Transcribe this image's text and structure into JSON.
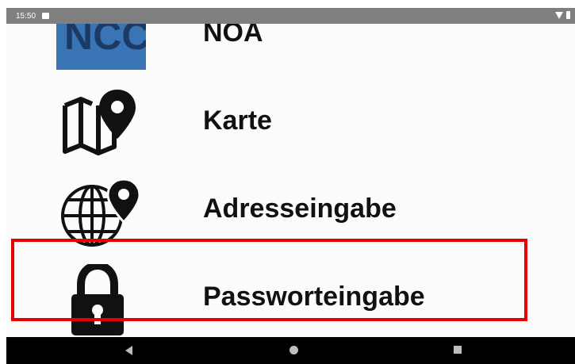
{
  "status_bar": {
    "time": "15:50",
    "notification_icon": "image-icon",
    "wifi_icon": "wifi-icon",
    "battery_icon": "battery-icon"
  },
  "menu": {
    "items": [
      {
        "label": "NOA",
        "logo_text": "NCC",
        "icon": "noa-logo",
        "logo_color": "#3b74b4"
      },
      {
        "label": "Karte",
        "icon": "map-pin-icon"
      },
      {
        "label": "Adresseingabe",
        "icon": "globe-pin-icon"
      },
      {
        "label": "Passworteingabe",
        "icon": "padlock-icon",
        "highlighted": true
      }
    ]
  },
  "highlight_color": "#e60000",
  "nav_bar": {
    "back_icon": "back-triangle-icon",
    "home_icon": "home-circle-icon",
    "recents_icon": "recents-square-icon"
  }
}
